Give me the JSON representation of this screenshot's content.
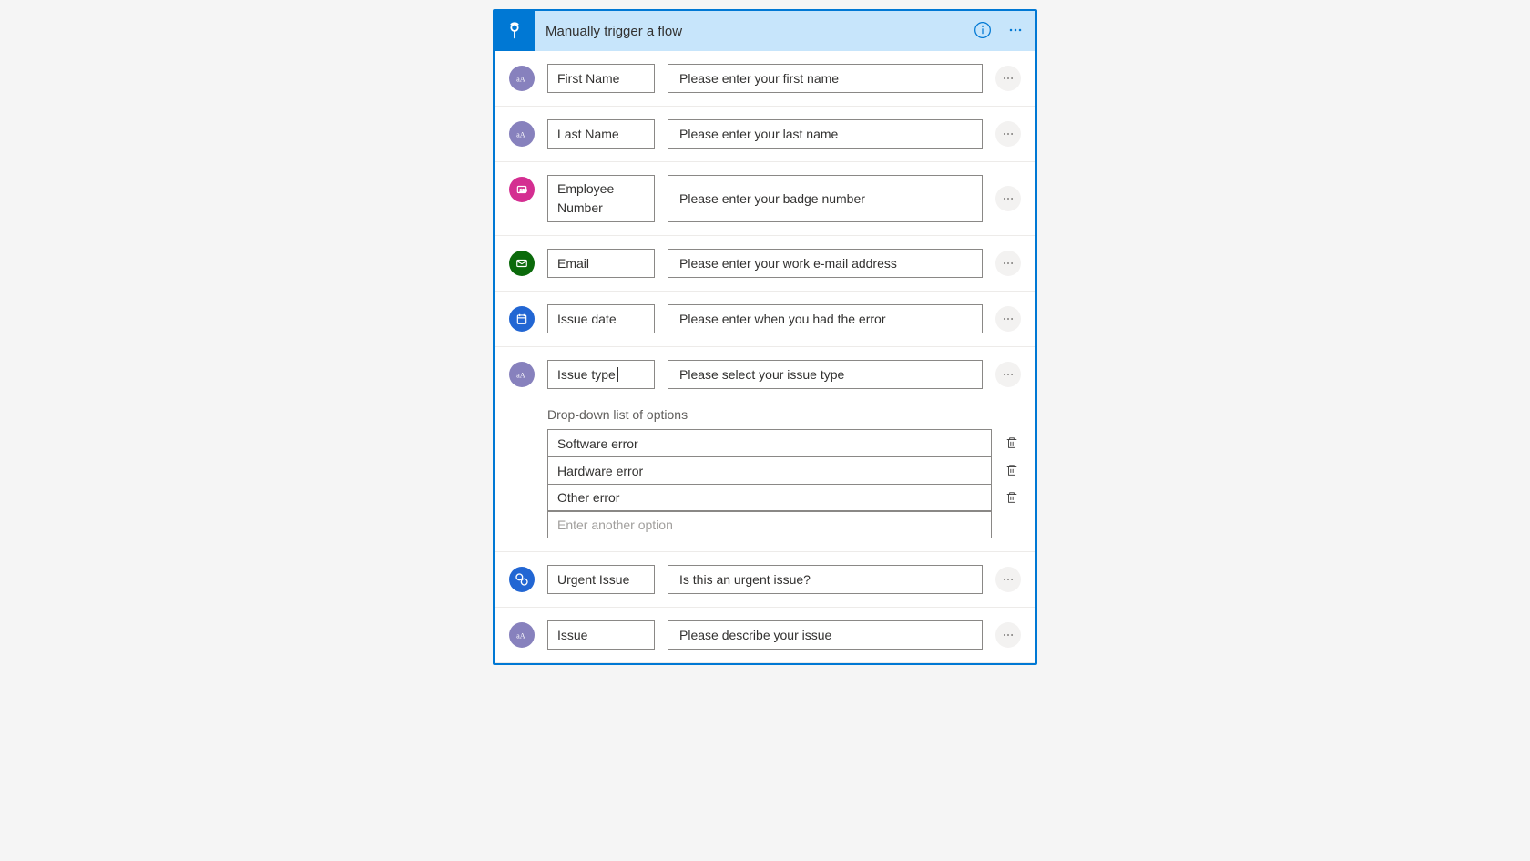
{
  "header": {
    "title": "Manually trigger a flow"
  },
  "inputs": [
    {
      "type": "text",
      "label": "First Name",
      "description": "Please enter your first name"
    },
    {
      "type": "text",
      "label": "Last Name",
      "description": "Please enter your last name"
    },
    {
      "type": "number",
      "label": "Employee Number",
      "description": "Please enter your badge number"
    },
    {
      "type": "email",
      "label": "Email",
      "description": "Please enter your work e-mail address"
    },
    {
      "type": "date",
      "label": "Issue date",
      "description": "Please enter when you had the error"
    },
    {
      "type": "text",
      "label": "Issue type",
      "description": "Please select your issue type",
      "has_cursor": true,
      "dropdown": {
        "label": "Drop-down list of options",
        "options": [
          "Software error",
          "Hardware error",
          "Other error"
        ],
        "new_placeholder": "Enter another option"
      }
    },
    {
      "type": "yesno",
      "label": "Urgent Issue",
      "description": "Is this an urgent issue?"
    },
    {
      "type": "text",
      "label": "Issue",
      "description": "Please describe your issue"
    }
  ]
}
